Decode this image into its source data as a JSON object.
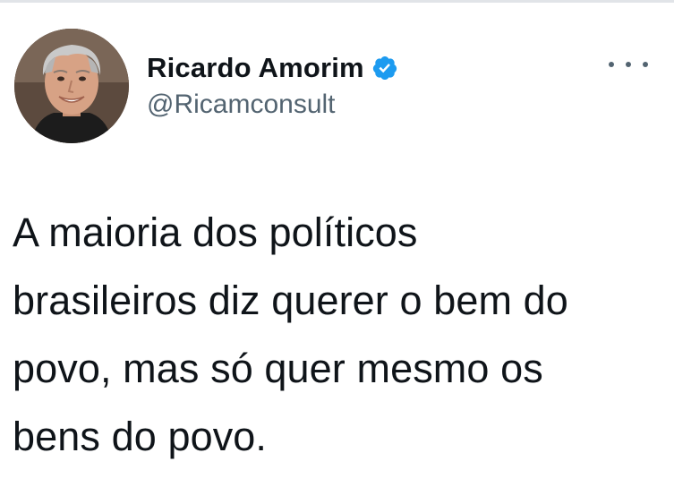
{
  "tweet": {
    "author": {
      "display_name": "Ricardo Amorim",
      "handle": "@Ricamconsult",
      "verified": true
    },
    "text_lines": [
      "A maioria dos políticos",
      "brasileiros diz querer o bem do",
      "povo, mas só quer mesmo os",
      "bens do povo."
    ]
  },
  "icons": {
    "verified": "verified-badge-icon",
    "more": "more-options-icon"
  },
  "colors": {
    "text_primary": "#0f1419",
    "text_secondary": "#536471",
    "verified_blue": "#1d9bf0",
    "divider": "#e1e4e8"
  }
}
